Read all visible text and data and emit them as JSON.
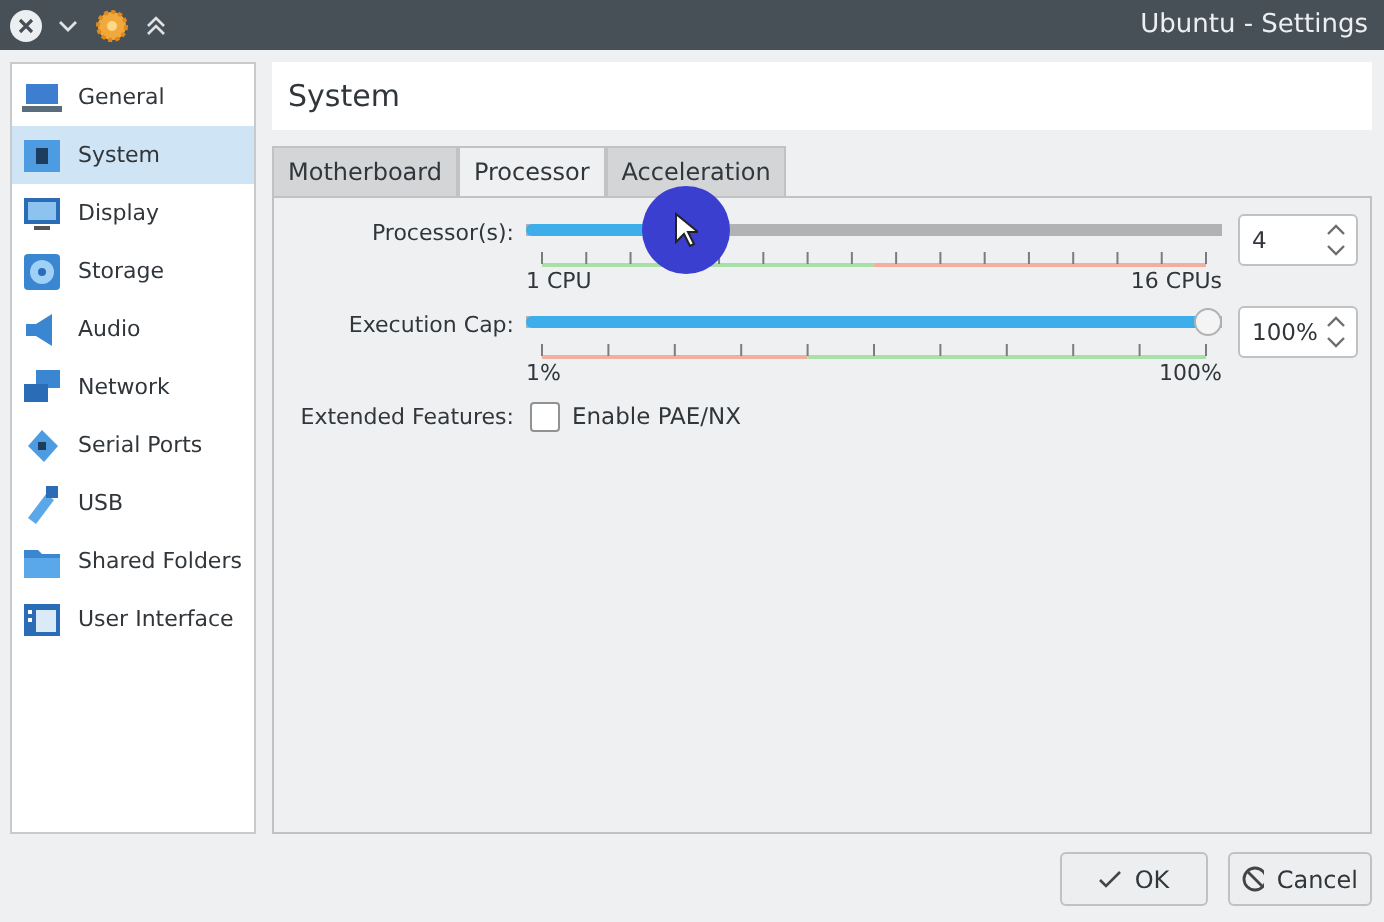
{
  "window": {
    "title": "Ubuntu - Settings"
  },
  "sidebar": {
    "items": [
      {
        "label": "General",
        "selected": false
      },
      {
        "label": "System",
        "selected": true
      },
      {
        "label": "Display",
        "selected": false
      },
      {
        "label": "Storage",
        "selected": false
      },
      {
        "label": "Audio",
        "selected": false
      },
      {
        "label": "Network",
        "selected": false
      },
      {
        "label": "Serial Ports",
        "selected": false
      },
      {
        "label": "USB",
        "selected": false
      },
      {
        "label": "Shared Folders",
        "selected": false
      },
      {
        "label": "User Interface",
        "selected": false
      }
    ]
  },
  "page_title": "System",
  "tabs": [
    {
      "label": "Motherboard",
      "selected": false
    },
    {
      "label": "Processor",
      "selected": true
    },
    {
      "label": "Acceleration",
      "selected": false
    }
  ],
  "sliders": [
    {
      "label": "Processor(s):",
      "level": 0.2,
      "min_label": "1 CPU",
      "max_label": "16 CPUs",
      "value": "4"
    },
    {
      "label": "Execution Cap:",
      "level": 1,
      "min_label": "1%",
      "max_label": "100%",
      "value": "100%"
    }
  ],
  "extended_features": {
    "label": "Extended Features:",
    "checkbox_label": "Enable PAE/NX",
    "checked": false
  },
  "buttons": [
    {
      "label": "OK",
      "kind": "ok"
    },
    {
      "label": "Cancel",
      "kind": "cancel"
    }
  ]
}
